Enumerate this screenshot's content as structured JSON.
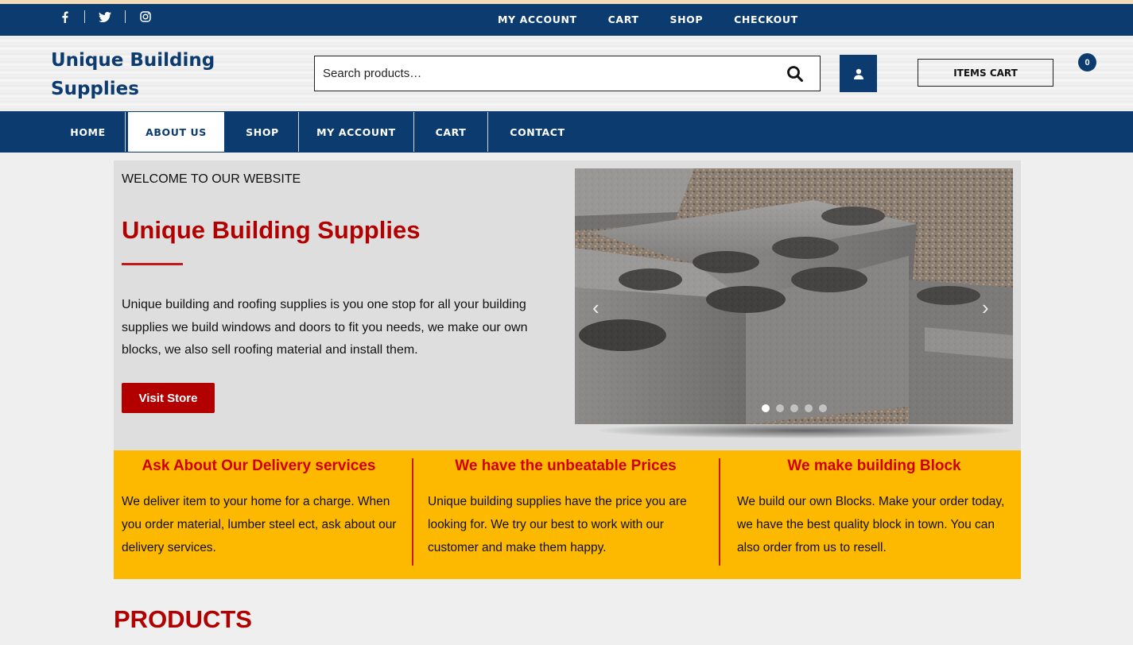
{
  "colors": {
    "primary": "#0b3b6f",
    "accent": "#b20000",
    "features_bg": "#fdb800"
  },
  "topbar": {
    "social": [
      {
        "icon": "facebook-icon"
      },
      {
        "icon": "twitter-icon"
      },
      {
        "icon": "instagram-icon"
      }
    ],
    "links": [
      "MY ACCOUNT",
      "CART",
      "SHOP",
      "CHECKOUT"
    ]
  },
  "header": {
    "logo": "Unique Building Supplies",
    "search_placeholder": "Search products…",
    "cart_label": "ITEMS CART",
    "cart_count": "0"
  },
  "nav": {
    "items": [
      "HOME",
      "ABOUT US",
      "SHOP",
      "MY ACCOUNT",
      "CART",
      "CONTACT"
    ],
    "active": "ABOUT US"
  },
  "hero": {
    "welcome": "WELCOME TO OUR WEBSITE",
    "title": "Unique Building Supplies",
    "text": "Unique building and roofing supplies is you one stop for all your building supplies we build windows and doors to fit you needs, we make our own blocks, we also sell roofing material and install them.",
    "button": "Visit Store",
    "slider_dots": 5,
    "active_dot": 1
  },
  "features": [
    {
      "title": "Ask About Our Delivery services",
      "text": "We deliver item to your home for a charge. When you order material, lumber steel ect, ask about our delivery services."
    },
    {
      "title": "We have the unbeatable Prices",
      "text": "Unique building supplies have the price you are looking for. We try our best to work with our customer and make them happy."
    },
    {
      "title": "We make building Block",
      "text": "We build our own Blocks. Make your order today, we have the best quality block in town. You can also order from us to resell."
    }
  ],
  "products_heading": "PRODUCTS"
}
